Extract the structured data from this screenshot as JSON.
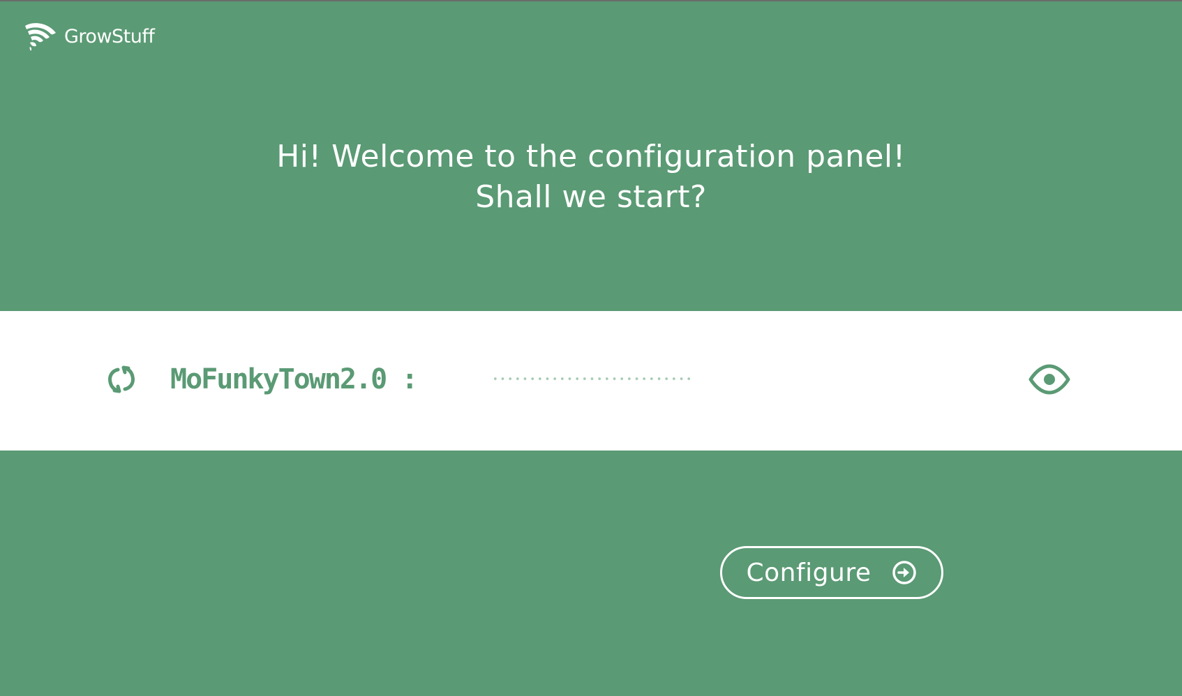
{
  "app": {
    "brand_name": "GrowStuff",
    "logo_icon": "growstuff-leaf-wifi-icon"
  },
  "colors": {
    "background": "#5a9a74",
    "band": "#ffffff",
    "accent": "#5a9a74",
    "password_dots": "#a7cbb5",
    "text_on_green": "#ffffff"
  },
  "welcome": {
    "line1": "Hi! Welcome to the configuration panel!",
    "line2": "Shall we start?"
  },
  "network": {
    "refresh_icon": "refresh-icon",
    "ssid_label": "MoFunkyTown2.0 :",
    "password_value": "•••••••••••••••••••••••••••",
    "password_masked": true,
    "visibility_icon": "eye-icon"
  },
  "actions": {
    "configure_label": "Configure",
    "configure_icon": "arrow-right-circle-icon"
  }
}
